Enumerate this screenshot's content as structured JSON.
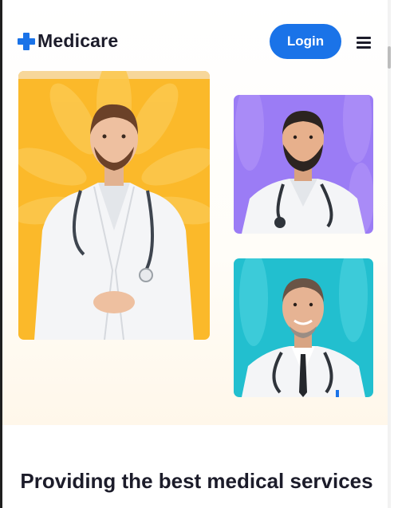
{
  "header": {
    "logo_text": "Medicare",
    "login_label": "Login",
    "menu_icon": "hamburger-menu-icon"
  },
  "hero": {
    "images": [
      {
        "subject": "doctor in white coat with stethoscope",
        "background_color": "#fbb92a"
      },
      {
        "subject": "bearded doctor with stethoscope",
        "background_color": "#9b7cf5"
      },
      {
        "subject": "smiling doctor with tie and stethoscope",
        "background_color": "#22bfcf"
      }
    ]
  },
  "section": {
    "heading": "Providing the best medical services"
  },
  "colors": {
    "brand_blue": "#1a73e8",
    "text_dark": "#1c1c2a"
  }
}
